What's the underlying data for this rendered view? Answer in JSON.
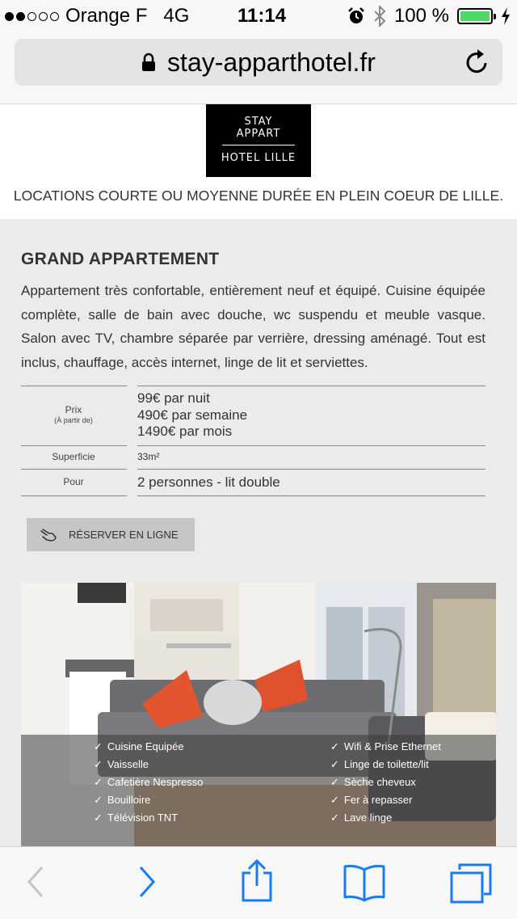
{
  "status_bar": {
    "carrier": "Orange F",
    "network": "4G",
    "time": "11:14",
    "battery": "100 %",
    "signal_bars": 2,
    "signal_total": 5
  },
  "browser": {
    "url": "stay-apparthotel.fr"
  },
  "header": {
    "logo_line1": "STAY",
    "logo_line2": "APPART",
    "logo_line3": "HOTEL LILLE",
    "tagline": "LOCATIONS COURTE OU MOYENNE DURÉE EN PLEIN COEUR DE LILLE."
  },
  "listing": {
    "title": "GRAND APPARTEMENT",
    "description": "Appartement très confortable, entièrement neuf et équipé. Cuisine équipée complète, salle de bain avec douche, wc suspendu et meuble vasque. Salon avec TV, chambre séparée par verrière, dressing aménagé. Tout est inclus, chauffage, accès internet, linge de lit et serviettes.",
    "price_label": "Prix",
    "price_sublabel": "(À partir de)",
    "prices": [
      "99€ par nuit",
      "490€ par semaine",
      "1490€ par mois"
    ],
    "area_label": "Superficie",
    "area_value": "33m²",
    "capacity_label": "Pour",
    "capacity_value": "2 personnes - lit double",
    "reserve_button": "RÉSERVER EN LIGNE"
  },
  "features": {
    "left": [
      "Cuisine Equipée",
      "Vaisselle",
      "Cafetière Nespresso",
      "Bouilloire",
      "Télévision TNT"
    ],
    "right": [
      "Wifi & Prise Ethernet",
      "Linge de toilette/lit",
      "Sèche cheveux",
      "Fer à repasser",
      "Lave linge"
    ],
    "check": "✓"
  },
  "colors": {
    "accent_blue": "#1a7cf5",
    "battery_green": "#4cd964",
    "logo_bg": "#000000",
    "button_bg": "#c6c6c6",
    "pillow": "#e2552f"
  }
}
